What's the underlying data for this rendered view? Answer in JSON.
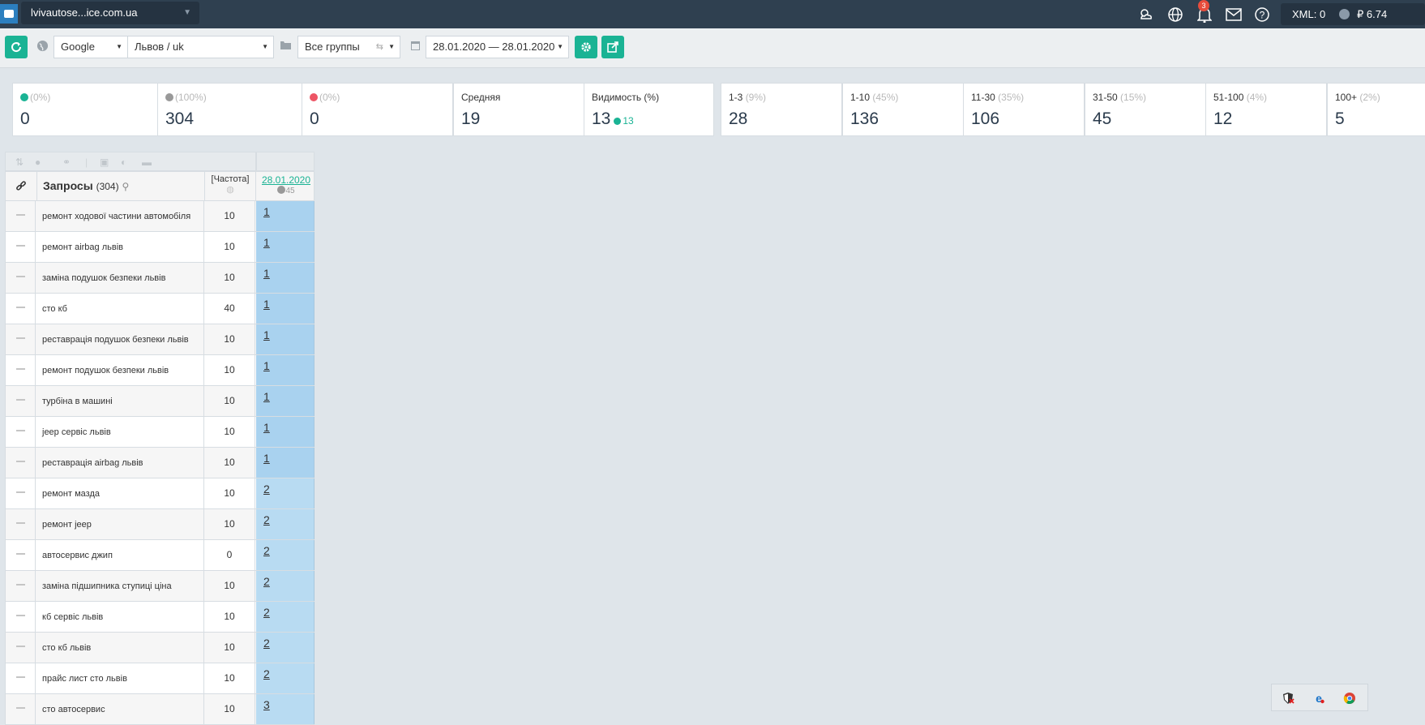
{
  "topbar": {
    "project": "lvivautose...ice.com.ua",
    "notifications_count": "3",
    "xml_label": "XML: 0",
    "balance": "₽ 6.74"
  },
  "toolbar": {
    "engine": "Google",
    "region": "Львов / uk",
    "group": "Все группы",
    "date_range": "28.01.2020 — 28.01.2020"
  },
  "stats": [
    {
      "id": "up",
      "label": "",
      "pct": "(0%)",
      "value": "0",
      "icon": "arrow-up-icon",
      "color": "#1ab394"
    },
    {
      "id": "same",
      "label": "",
      "pct": "(100%)",
      "value": "304",
      "icon": "minus-icon",
      "color": "#999999"
    },
    {
      "id": "down",
      "label": "",
      "pct": "(0%)",
      "value": "0",
      "icon": "arrow-down-icon",
      "color": "#ed5565"
    },
    {
      "id": "avg",
      "label": "Средняя",
      "pct": "",
      "value": "19"
    },
    {
      "id": "visibility",
      "label": "Видимость (%)",
      "pct": "",
      "value": "13",
      "delta": "13"
    },
    {
      "id": "r1-3",
      "label": "1-3",
      "pct": "(9%)",
      "value": "28"
    },
    {
      "id": "r1-10",
      "label": "1-10",
      "pct": "(45%)",
      "value": "136"
    },
    {
      "id": "r11-30",
      "label": "11-30",
      "pct": "(35%)",
      "value": "106"
    },
    {
      "id": "r31-50",
      "label": "31-50",
      "pct": "(15%)",
      "value": "45"
    },
    {
      "id": "r51-100",
      "label": "51-100",
      "pct": "(4%)",
      "value": "12"
    },
    {
      "id": "r100",
      "label": "100+",
      "pct": "(2%)",
      "value": "5"
    }
  ],
  "table": {
    "queries_header": "Запросы",
    "queries_count": "(304)",
    "freq_header": "[Частота]",
    "date_header": "28.01.2020",
    "date_sub": "45",
    "rows": [
      {
        "query": "ремонт ходової частини автомобіля",
        "freq": "10",
        "pos": "1"
      },
      {
        "query": "ремонт airbag львів",
        "freq": "10",
        "pos": "1"
      },
      {
        "query": "заміна подушок безпеки львів",
        "freq": "10",
        "pos": "1"
      },
      {
        "query": "сто кб",
        "freq": "40",
        "pos": "1"
      },
      {
        "query": "реставрація подушок безпеки львів",
        "freq": "10",
        "pos": "1"
      },
      {
        "query": "ремонт подушок безпеки львів",
        "freq": "10",
        "pos": "1"
      },
      {
        "query": "турбіна в машині",
        "freq": "10",
        "pos": "1"
      },
      {
        "query": "jeep сервіс львів",
        "freq": "10",
        "pos": "1"
      },
      {
        "query": "реставрація airbag львів",
        "freq": "10",
        "pos": "1"
      },
      {
        "query": "ремонт мазда",
        "freq": "10",
        "pos": "2"
      },
      {
        "query": "ремонт jeep",
        "freq": "10",
        "pos": "2"
      },
      {
        "query": "автосервис джип",
        "freq": "0",
        "pos": "2"
      },
      {
        "query": "заміна підшипника ступиці ціна",
        "freq": "10",
        "pos": "2"
      },
      {
        "query": "кб сервіс львів",
        "freq": "10",
        "pos": "2"
      },
      {
        "query": "сто кб львів",
        "freq": "10",
        "pos": "2"
      },
      {
        "query": "прайс лист сто львів",
        "freq": "10",
        "pos": "2"
      },
      {
        "query": "сто автосервис",
        "freq": "10",
        "pos": "3"
      }
    ]
  }
}
